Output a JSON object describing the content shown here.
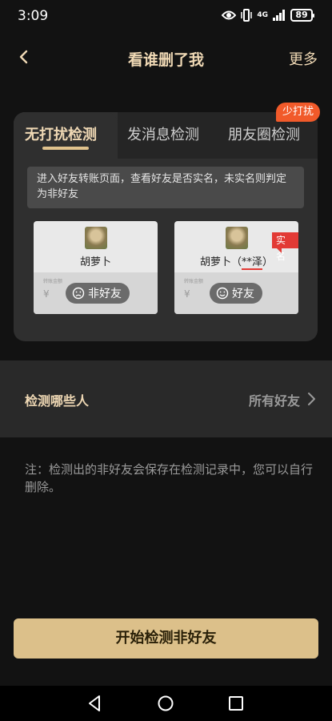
{
  "status_bar": {
    "time": "3:09",
    "network": "4G",
    "battery": "89"
  },
  "header": {
    "title": "看谁删了我",
    "more_label": "更多"
  },
  "mode_tabs": {
    "items": [
      {
        "label": "无打扰检测",
        "active": true
      },
      {
        "label": "发消息检测",
        "active": false
      },
      {
        "label": "朋友圈检测",
        "active": false
      }
    ],
    "badge": "少打扰"
  },
  "description": "进入好友转账页面，查看好友是否实名，未实名则判定为非好友",
  "preview": {
    "left": {
      "name": "胡萝卜",
      "status": "非好友",
      "amount_label": "转账金额",
      "currency": "¥"
    },
    "right": {
      "name_prefix": "胡萝卜（",
      "name_highlight": "**泽",
      "name_suffix": "）",
      "status": "好友",
      "amount_label": "转账金额",
      "currency": "¥",
      "tag": "实名"
    }
  },
  "detect": {
    "label": "检测哪些人",
    "value": "所有好友"
  },
  "note": "注：检测出的非好友会保存在检测记录中，您可以自行删除。",
  "start_button": "开始检测非好友",
  "icons": [
    "back-icon",
    "chevron-right-icon",
    "sad-face-icon",
    "smile-face-icon",
    "nav-back-icon",
    "nav-home-icon",
    "nav-recents-icon",
    "eye-icon",
    "vibrate-icon",
    "signal-icon"
  ]
}
